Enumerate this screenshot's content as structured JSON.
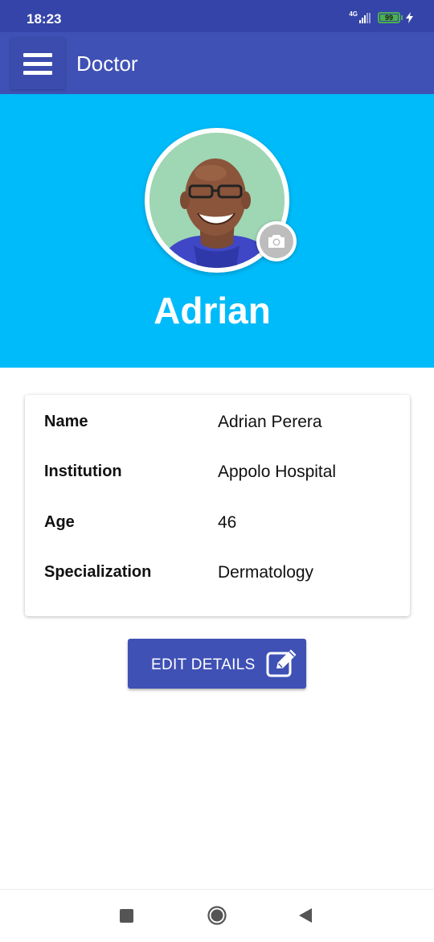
{
  "status_bar": {
    "time": "18:23",
    "network": "4G",
    "battery": "99"
  },
  "app_bar": {
    "title": "Doctor",
    "menu_icon": "hamburger-menu-icon"
  },
  "profile": {
    "display_name": "Adrian",
    "camera_icon": "camera-icon"
  },
  "details": [
    {
      "label": "Name",
      "value": "Adrian Perera"
    },
    {
      "label": "Institution",
      "value": "Appolo Hospital"
    },
    {
      "label": "Age",
      "value": "46"
    },
    {
      "label": "Specialization",
      "value": "Dermatology"
    }
  ],
  "edit_button": {
    "label": "EDIT DETAILS",
    "icon": "edit-icon"
  },
  "colors": {
    "primary": "#3f51b5",
    "status_bar": "#3544a8",
    "hero": "#00bbf9",
    "battery": "#4caf50"
  }
}
